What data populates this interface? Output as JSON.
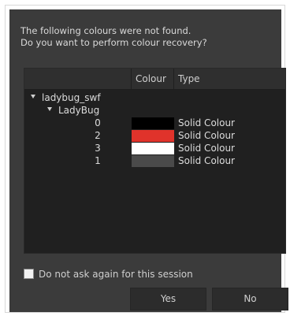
{
  "message": {
    "line1": "The following colours were not found.",
    "line2": "Do you want to perform colour recovery?"
  },
  "table": {
    "headers": {
      "name": "",
      "colour": "Colour",
      "type": "Type"
    },
    "root": {
      "label": "ladybug_swf"
    },
    "group": {
      "label": "LadyBug"
    },
    "items": [
      {
        "index": "0",
        "colour": "#000000",
        "type": "Solid Colour"
      },
      {
        "index": "2",
        "colour": "#e0332b",
        "type": "Solid Colour"
      },
      {
        "index": "3",
        "colour": "#ffffff",
        "type": "Solid Colour"
      },
      {
        "index": "1",
        "colour": "#4a4a4a",
        "type": "Solid Colour"
      }
    ]
  },
  "options": {
    "do_not_ask_label": "Do not ask again for this session",
    "do_not_ask_checked": false
  },
  "buttons": {
    "yes": "Yes",
    "no": "No"
  }
}
